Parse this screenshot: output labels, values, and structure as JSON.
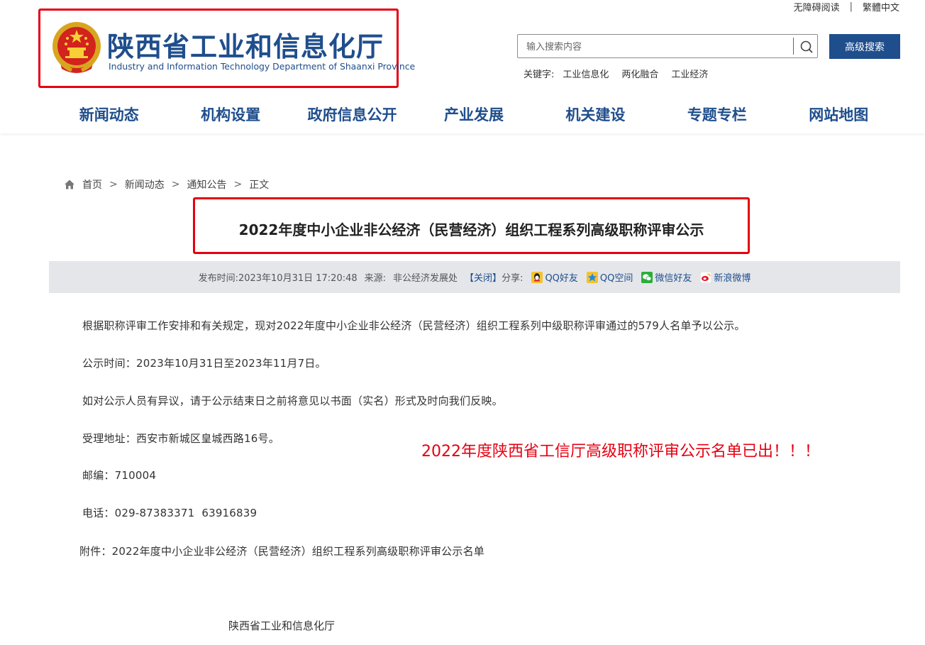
{
  "top_links": {
    "accessible": "无障碍阅读",
    "traditional": "繁體中文"
  },
  "logo": {
    "cn": "陕西省工业和信息化厅",
    "en": "Industry and Information Technology Department of Shaanxi Province"
  },
  "search": {
    "placeholder": "输入搜索内容",
    "advanced_label": "高级搜索"
  },
  "keywords": {
    "label": "关键字:",
    "items": [
      "工业信息化",
      "两化融合",
      "工业经济"
    ]
  },
  "nav": [
    "新闻动态",
    "机构设置",
    "政府信息公开",
    "产业发展",
    "机关建设",
    "专题专栏",
    "网站地图"
  ],
  "breadcrumb": {
    "items": [
      "首页",
      "新闻动态",
      "通知公告",
      "正文"
    ],
    "separator": ">"
  },
  "article": {
    "title": "2022年度中小企业非公经济（民营经济）组织工程系列高级职称评审公示",
    "meta": {
      "publish_label": "发布时间:",
      "publish_time": "2023年10月31日 17:20:48",
      "source_label": "来源:",
      "source": "非公经济发展处",
      "close": "【关闭】",
      "share_label": "分享:",
      "share": [
        "QQ好友",
        "QQ空间",
        "微信好友",
        "新浪微博"
      ]
    },
    "paragraphs": [
      "根据职称评审工作安排和有关规定，现对2022年度中小企业非公经济（民营经济）组织工程系列中级职称评审通过的579人名单予以公示。",
      "公示时间：2023年10月31日至2023年11月7日。",
      "如对公示人员有异议，请于公示结束日之前将意见以书面（实名）形式及时向我们反映。",
      "受理地址：西安市新城区皇城西路16号。",
      "邮编：710004",
      "电话：029-87383371  63916839"
    ],
    "attachment": "附件：2022年度中小企业非公经济（民营经济）组织工程系列高级职称评审公示名单",
    "annotation": "2022年度陕西省工信厅高级职称评审公示名单已出！！！",
    "signature": "陕西省工业和信息化厅"
  },
  "colors": {
    "brand": "#1f4e8c",
    "highlight": "#e60012",
    "meta_bg": "#e4e6ea"
  }
}
